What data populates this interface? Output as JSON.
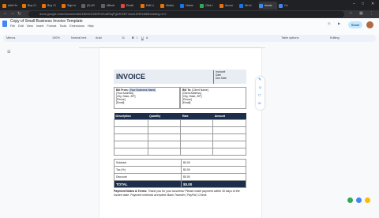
{
  "browser": {
    "tabs": [
      {
        "label": "Add Ho",
        "color": "#e8710a"
      },
      {
        "label": "Buy Cl",
        "color": "#e8710a"
      },
      {
        "label": "Buy Cl",
        "color": "#e8710a"
      },
      {
        "label": "Sign in",
        "color": "#e8710a"
      },
      {
        "label": "(2) Wl",
        "color": "#5f6368"
      },
      {
        "label": "eBook",
        "color": "#5f6368"
      },
      {
        "label": "Email",
        "color": "#ea4335"
      },
      {
        "label": "Edit Li",
        "color": "#e8710a"
      },
      {
        "label": "Vimbo",
        "color": "#e8710a"
      },
      {
        "label": "Home",
        "color": "#1a73e8"
      },
      {
        "label": "Click l",
        "color": "#34a853"
      },
      {
        "label": "Accou",
        "color": "#e8710a"
      },
      {
        "label": "Mv ki",
        "color": "#1a73e8"
      },
      {
        "label": "Invoic",
        "color": "#4285f4"
      },
      {
        "label": "Co",
        "color": "#4285f4"
      }
    ],
    "url": "docs.google.com/document/d/1BeKrD3tDPnHoaRkqPgDKS3tT1sxcLfbR/edit#heading=h.0"
  },
  "docs": {
    "title": "Copy of Small Business Invoice Template",
    "menu": [
      "File",
      "Edit",
      "View",
      "Insert",
      "Format",
      "Tools",
      "Extensions",
      "Help"
    ],
    "share": "Share",
    "toolbar": {
      "menus": "Menus",
      "zoom": "100%",
      "style": "Normal text",
      "font": "Arial",
      "size": "11",
      "bold": "B",
      "italic": "I",
      "underline": "U",
      "text_color": "A",
      "more": "Table options",
      "editing": "Editing"
    }
  },
  "invoice": {
    "title": "INVOICE",
    "meta": [
      "Invoice#",
      "Date",
      "Due Date"
    ],
    "bill_from": {
      "label": "Bill From:",
      "name": "[Your Business Name]",
      "lines": [
        "[Your Address]",
        "[City, State, ZIP]",
        "[Phone]",
        "[Email]"
      ]
    },
    "bill_to": {
      "label": "Bill To:",
      "name": "[Client Name]",
      "lines": [
        "[Client Address]",
        "[City, State, ZIP]",
        "[Phone]",
        "[Email]"
      ]
    },
    "columns": [
      "Description",
      "Quantity",
      "Rate",
      "Amount"
    ],
    "blank_rows": 5,
    "totals": [
      {
        "label": "Subtotal",
        "value": "$0.00"
      },
      {
        "label": "Tax (%)",
        "value": "$0.00"
      },
      {
        "label": "Discount",
        "value": "$0.00"
      },
      {
        "label": "TOTAL",
        "value": "$0.00"
      }
    ],
    "notes_label": "Payment Notes & Terms:",
    "notes_text": "Thank you for your business! Please make payment within 30 days of the invoice date. Payment methods accepted: Bank Transfer | PayPal | Check."
  }
}
